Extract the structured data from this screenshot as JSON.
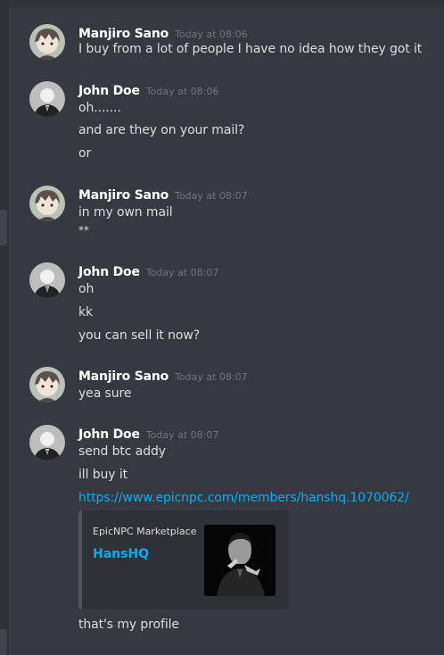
{
  "messages": [
    {
      "author": "Manjiro Sano",
      "time": "Today at 08:06",
      "lines": [
        "I buy from a lot of people I have no idea how they got it"
      ]
    },
    {
      "author": "John Doe",
      "time": "Today at 08:06",
      "lines": [
        "oh.......",
        "and are they on your mail?",
        "or"
      ]
    },
    {
      "author": "Manjiro Sano",
      "time": "Today at 08:07",
      "lines": [
        "in my own mail",
        "**"
      ]
    },
    {
      "author": "John Doe",
      "time": "Today at 08:07",
      "lines": [
        "oh",
        "kk",
        "you can sell it now?"
      ]
    },
    {
      "author": "Manjiro Sano",
      "time": "Today at 08:07",
      "lines": [
        "yea sure"
      ]
    },
    {
      "author": "John Doe",
      "time": "Today at 08:07",
      "lines": [
        "send btc addy",
        "ill buy it"
      ],
      "link": "https://www.epicnpc.com/members/hanshq.1070062/",
      "embed": {
        "provider": "EpicNPC Marketplace",
        "title": "HansHQ",
        "thumbnail_icon": "profile-photo-thumbnail"
      },
      "after_embed": "that's my profile"
    }
  ],
  "colors": {
    "background": "#36393f",
    "text": "#dcddde",
    "username": "#ffffff",
    "timestamp": "#72767d",
    "link": "#00b0f4",
    "embed_bg": "#2f3136",
    "embed_border": "#4f545c"
  }
}
